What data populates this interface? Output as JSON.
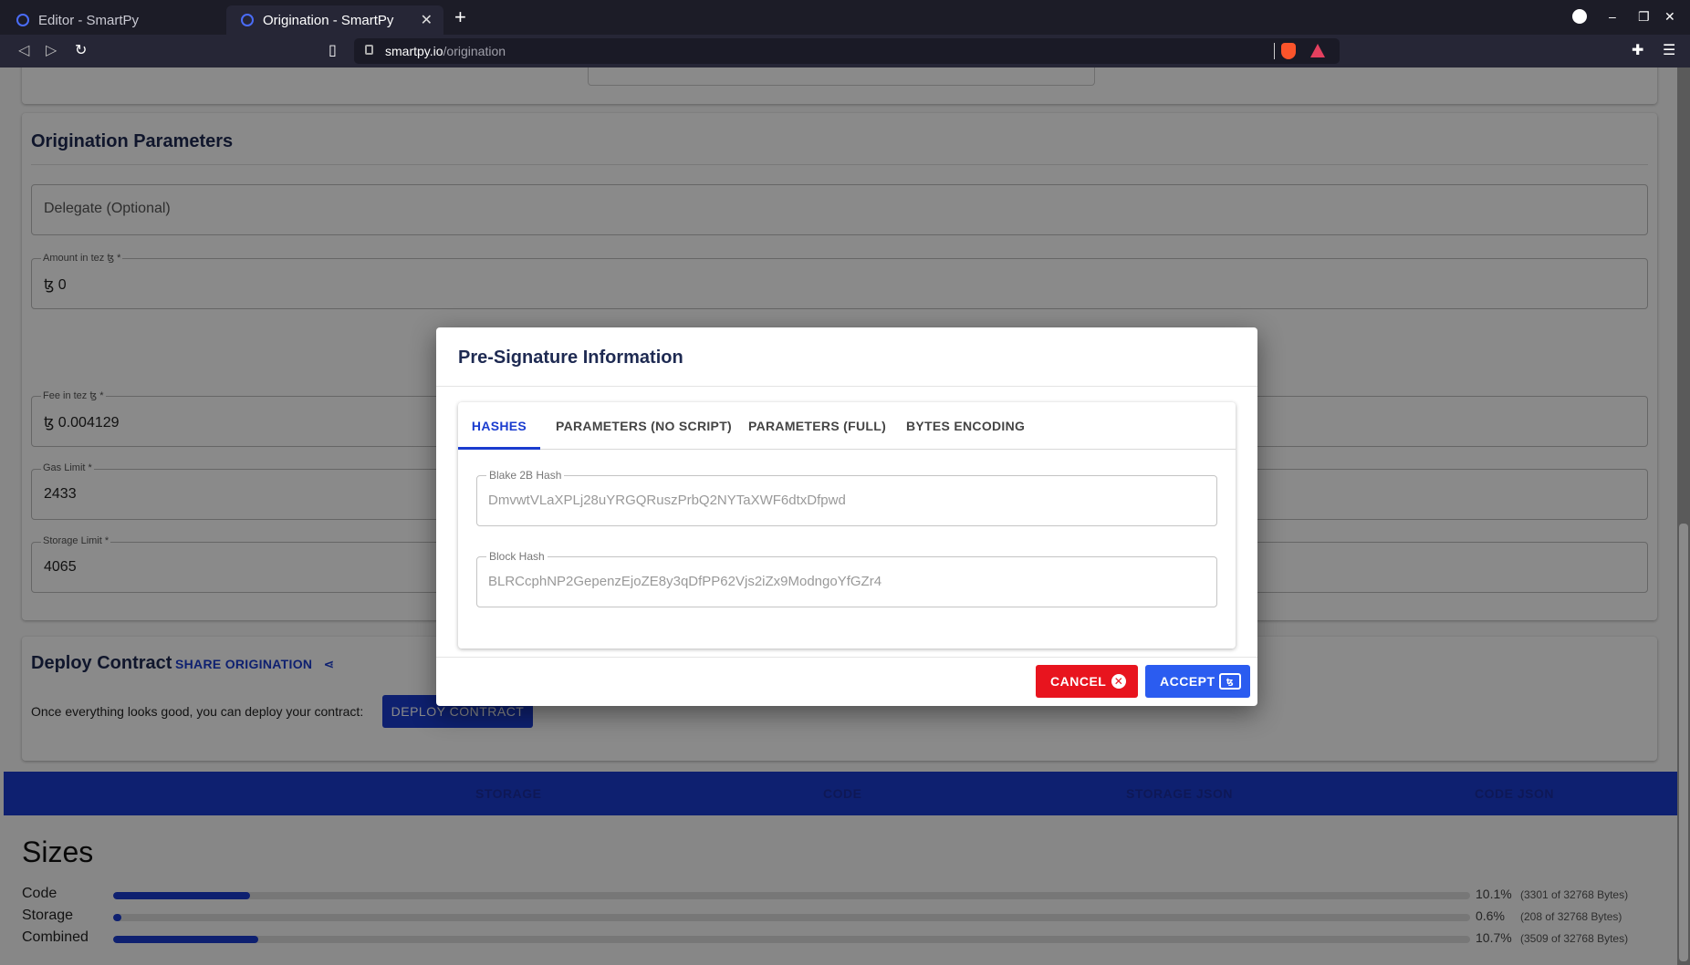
{
  "browser": {
    "tabs": [
      {
        "title": "Editor - SmartPy"
      },
      {
        "title": "Origination - SmartPy"
      }
    ],
    "url_host": "smartpy.io",
    "url_path": "/origination"
  },
  "origination": {
    "title": "Origination Parameters",
    "delegate_placeholder": "Delegate (Optional)",
    "amount_label": "Amount in tez ꜩ *",
    "amount_value": "ꜩ 0",
    "fee_label": "Fee in tez ꜩ *",
    "fee_value": "ꜩ 0.004129",
    "gas_label": "Gas Limit *",
    "gas_value": "2433",
    "storage_label": "Storage Limit *",
    "storage_value": "4065"
  },
  "deploy": {
    "title": "Deploy Contract",
    "share_label": "SHARE ORIGINATION",
    "description": "Once everything looks good, you can deploy your contract:",
    "deploy_button": "DEPLOY CONTRACT"
  },
  "view_tabs": [
    "STORAGE",
    "CODE",
    "STORAGE JSON",
    "CODE JSON"
  ],
  "sizes": {
    "title": "Sizes",
    "rows": [
      {
        "name": "Code",
        "fraction": 0.101,
        "percent": "10.1%",
        "bytes": "(3301 of 32768 Bytes)"
      },
      {
        "name": "Storage",
        "fraction": 0.006,
        "percent": "0.6%",
        "bytes": "(208 of 32768 Bytes)"
      },
      {
        "name": "Combined",
        "fraction": 0.107,
        "percent": "10.7%",
        "bytes": "(3509 of 32768 Bytes)"
      }
    ]
  },
  "dialog": {
    "title": "Pre-Signature Information",
    "tabs": [
      "HASHES",
      "PARAMETERS (NO SCRIPT)",
      "PARAMETERS (FULL)",
      "BYTES ENCODING"
    ],
    "blake_label": "Blake 2B Hash",
    "blake_value": "DmvwtVLaXPLj28uYRGQRuszPrbQ2NYTaXWF6dtxDfpwd",
    "block_label": "Block Hash",
    "block_value": "BLRCcphNP2GepenzEjoZE8y3qDfPP62Vjs2iZx9ModngoYfGZr4",
    "cancel_label": "CANCEL",
    "accept_label": "ACCEPT",
    "accept_icon_text": "ꜩ"
  },
  "colors": {
    "primary": "#1a3ccf",
    "cancel": "#e8141e",
    "accept": "#2b5cf0"
  }
}
